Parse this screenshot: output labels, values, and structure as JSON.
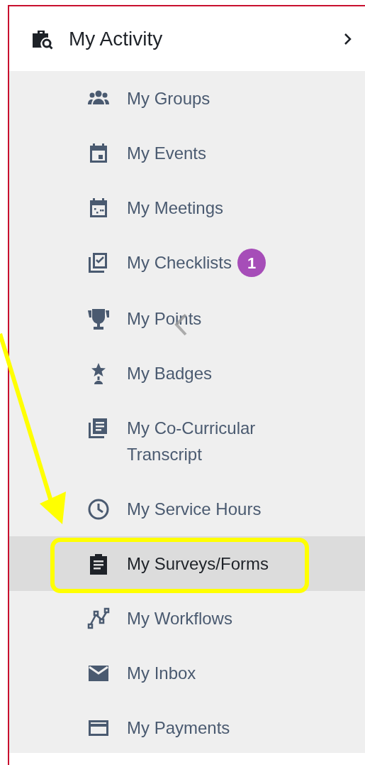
{
  "section": {
    "title": "My Activity",
    "expanded": true
  },
  "items": [
    {
      "label": "My Groups",
      "selected": false
    },
    {
      "label": "My Events",
      "selected": false
    },
    {
      "label": "My Meetings",
      "selected": false
    },
    {
      "label": "My Checklists",
      "selected": false,
      "badge": "1"
    },
    {
      "label": "My Points",
      "selected": false
    },
    {
      "label": "My Badges",
      "selected": false
    },
    {
      "label": "My Co-Curricular Transcript",
      "selected": false
    },
    {
      "label": "My Service Hours",
      "selected": false
    },
    {
      "label": "My Surveys/Forms",
      "selected": true
    },
    {
      "label": "My Workflows",
      "selected": false
    },
    {
      "label": "My Inbox",
      "selected": false
    },
    {
      "label": "My Payments",
      "selected": false
    }
  ]
}
